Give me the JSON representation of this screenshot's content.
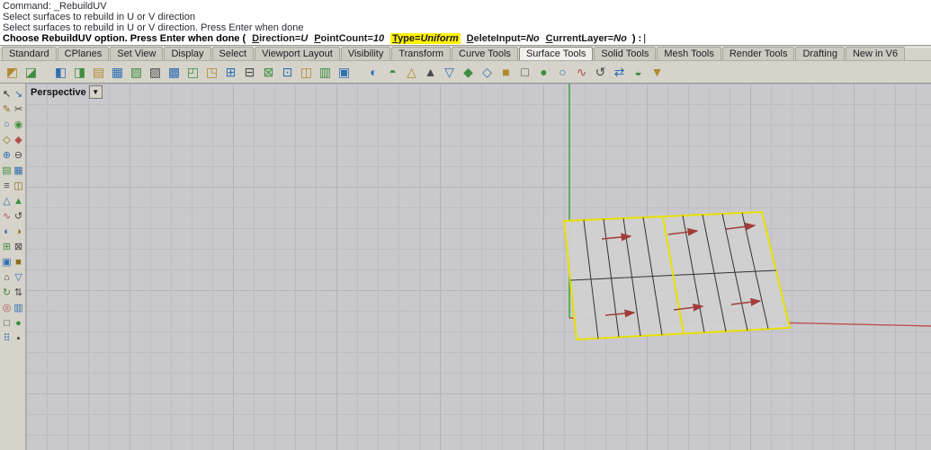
{
  "command_history": {
    "lines": [
      "Command: _RebuildUV",
      "Select surfaces to rebuild in U or V direction",
      "Select surfaces to rebuild in U or V direction. Press Enter when done"
    ]
  },
  "command_prompt": {
    "prefix": "Choose RebuildUV option. Press Enter when done (",
    "options": [
      {
        "label": "Direction",
        "value": "U",
        "highlight": false
      },
      {
        "label": "PointCount",
        "value": "10",
        "highlight": false
      },
      {
        "label": "Type",
        "value": "Uniform",
        "highlight": true
      },
      {
        "label": "DeleteInput",
        "value": "No",
        "highlight": false
      },
      {
        "label": "CurrentLayer",
        "value": "No",
        "highlight": false
      }
    ],
    "suffix": ") :",
    "cursor": "|",
    "highlight_color": "#fff200"
  },
  "tab_bar": {
    "tabs": [
      {
        "label": "Standard",
        "active": false
      },
      {
        "label": "CPlanes",
        "active": false
      },
      {
        "label": "Set View",
        "active": false
      },
      {
        "label": "Display",
        "active": false
      },
      {
        "label": "Select",
        "active": false
      },
      {
        "label": "Viewport Layout",
        "active": false
      },
      {
        "label": "Visibility",
        "active": false
      },
      {
        "label": "Transform",
        "active": false
      },
      {
        "label": "Curve Tools",
        "active": false
      },
      {
        "label": "Surface Tools",
        "active": true
      },
      {
        "label": "Solid Tools",
        "active": false
      },
      {
        "label": "Mesh Tools",
        "active": false
      },
      {
        "label": "Render Tools",
        "active": false
      },
      {
        "label": "Drafting",
        "active": false
      },
      {
        "label": "New in V6",
        "active": false
      }
    ]
  },
  "toolbar": {
    "groups": [
      [
        {
          "g": "◩",
          "c": "#b08a2e"
        },
        {
          "g": "◪",
          "c": "#3e8e41"
        }
      ],
      [
        {
          "g": "◧",
          "c": "#2f6fb2"
        },
        {
          "g": "◨",
          "c": "#3e8e41"
        },
        {
          "g": "▤",
          "c": "#b08a2e"
        },
        {
          "g": "▦",
          "c": "#2f6fb2"
        },
        {
          "g": "▧",
          "c": "#3e8e41"
        },
        {
          "g": "▨",
          "c": "#4a4a4a"
        },
        {
          "g": "▩",
          "c": "#2f6fb2"
        },
        {
          "g": "◰",
          "c": "#3e8e41"
        },
        {
          "g": "◳",
          "c": "#b08a2e"
        },
        {
          "g": "⊞",
          "c": "#2f6fb2"
        },
        {
          "g": "⊟",
          "c": "#4a4a4a"
        },
        {
          "g": "⊠",
          "c": "#3e8e41"
        },
        {
          "g": "⊡",
          "c": "#2f6fb2"
        },
        {
          "g": "◫",
          "c": "#b08a2e"
        },
        {
          "g": "▥",
          "c": "#3e8e41"
        },
        {
          "g": "▣",
          "c": "#2f6fb2"
        }
      ],
      [
        {
          "g": "◐",
          "c": "#2f6fb2"
        },
        {
          "g": "◓",
          "c": "#3e8e41"
        },
        {
          "g": "△",
          "c": "#b08a2e"
        },
        {
          "g": "▲",
          "c": "#4a4a4a"
        },
        {
          "g": "▽",
          "c": "#2f6fb2"
        },
        {
          "g": "◆",
          "c": "#3e8e41"
        },
        {
          "g": "◇",
          "c": "#2f6fb2"
        },
        {
          "g": "■",
          "c": "#b08a2e"
        },
        {
          "g": "□",
          "c": "#4a4a4a"
        },
        {
          "g": "●",
          "c": "#3e8e41"
        },
        {
          "g": "○",
          "c": "#2f6fb2"
        },
        {
          "g": "∿",
          "c": "#b05050"
        },
        {
          "g": "↺",
          "c": "#4a4a4a"
        },
        {
          "g": "⇄",
          "c": "#2f6fb2"
        },
        {
          "g": "◒",
          "c": "#3e8e41"
        },
        {
          "g": "▼",
          "c": "#b08a2e"
        }
      ]
    ]
  },
  "sidebar": {
    "icons": [
      {
        "g": "↖",
        "c": "#222222"
      },
      {
        "g": "↘",
        "c": "#2f6fb2"
      },
      {
        "g": "✎",
        "c": "#8a6d1c"
      },
      {
        "g": "✂",
        "c": "#444444"
      },
      {
        "g": "○",
        "c": "#2f6fb2"
      },
      {
        "g": "◉",
        "c": "#3e8e41"
      },
      {
        "g": "◇",
        "c": "#8a6d1c"
      },
      {
        "g": "◆",
        "c": "#b05050"
      },
      {
        "g": "⊕",
        "c": "#2f6fb2"
      },
      {
        "g": "⊖",
        "c": "#444444"
      },
      {
        "g": "▤",
        "c": "#3e8e41"
      },
      {
        "g": "▦",
        "c": "#2f6fb2"
      },
      {
        "g": "≡",
        "c": "#444444"
      },
      {
        "g": "◫",
        "c": "#8a6d1c"
      },
      {
        "g": "△",
        "c": "#2f6fb2"
      },
      {
        "g": "▲",
        "c": "#3e8e41"
      },
      {
        "g": "∿",
        "c": "#b05050"
      },
      {
        "g": "↺",
        "c": "#444444"
      },
      {
        "g": "◐",
        "c": "#2f6fb2"
      },
      {
        "g": "◑",
        "c": "#8a6d1c"
      },
      {
        "g": "⊞",
        "c": "#3e8e41"
      },
      {
        "g": "⊠",
        "c": "#444444"
      },
      {
        "g": "▣",
        "c": "#2f6fb2"
      },
      {
        "g": "■",
        "c": "#8a6d1c"
      },
      {
        "g": "⌂",
        "c": "#444444"
      },
      {
        "g": "▽",
        "c": "#2f6fb2"
      },
      {
        "g": "↻",
        "c": "#3e8e41"
      },
      {
        "g": "⇅",
        "c": "#444444"
      },
      {
        "g": "◎",
        "c": "#b05050"
      },
      {
        "g": "▥",
        "c": "#2f6fb2"
      },
      {
        "g": "□",
        "c": "#444444"
      },
      {
        "g": "●",
        "c": "#3e8e41"
      },
      {
        "g": "⠿",
        "c": "#2f6fb2"
      },
      {
        "g": "▪",
        "c": "#444444"
      }
    ]
  },
  "viewport": {
    "title": "Perspective",
    "dropdown_icon": "▼",
    "colors": {
      "background": "#c9c9cd",
      "grid_minor": "#bcbcc3",
      "grid_major": "#b2b2ba",
      "axis_y_green": "#2da52d",
      "axis_x_red": "#bf4f4f",
      "surface_outline_yellow": "#e8e000",
      "surface_fill": "#cfcfcf",
      "isocurve_black": "#333333",
      "direction_arrow_red": "#a33b3b"
    }
  }
}
